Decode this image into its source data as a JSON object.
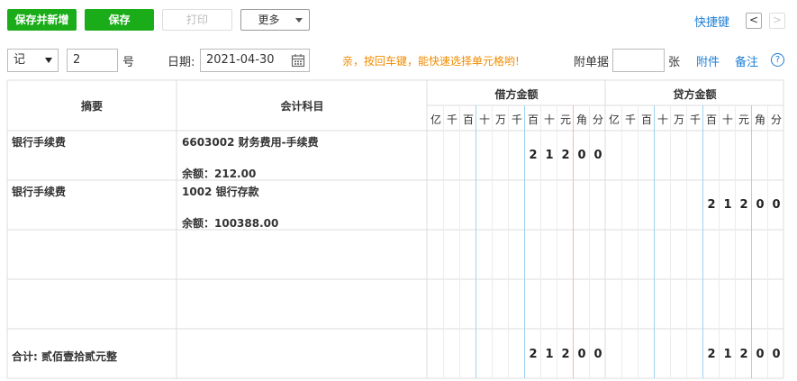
{
  "toolbar": {
    "save_new_label": "保存并新增",
    "save_label": "保存",
    "print_label": "打印",
    "more_label": "更多",
    "shortcut_label": "快捷键",
    "prev_label": "<",
    "next_label": ">"
  },
  "voucher": {
    "type_value": "记",
    "number_value": "2",
    "number_unit": "号",
    "date_label": "日期:",
    "date_value": "2021-04-30",
    "tip": "亲，按回车键，能快速选择单元格哟!",
    "attach_label": "附单据",
    "attach_value": "",
    "attach_unit": "张",
    "attachment_link": "附件",
    "remark_link": "备注",
    "help_icon": "?"
  },
  "table": {
    "col_summary": "摘要",
    "col_account": "会计科目",
    "col_debit": "借方金额",
    "col_credit": "贷方金额",
    "units": [
      "亿",
      "千",
      "百",
      "十",
      "万",
      "千",
      "百",
      "十",
      "元",
      "角",
      "分"
    ],
    "rows": [
      {
        "summary": "银行手续费",
        "account": "6603002 财务费用-手续费",
        "balance": "余额：212.00",
        "debit": "21200",
        "credit": ""
      },
      {
        "summary": "银行手续费",
        "account": "1002 银行存款",
        "balance": "余额：100388.00",
        "debit": "",
        "credit": "21200"
      },
      {
        "summary": "",
        "account": "",
        "balance": "",
        "debit": "",
        "credit": ""
      },
      {
        "summary": "",
        "account": "",
        "balance": "",
        "debit": "",
        "credit": ""
      }
    ],
    "total_label": "合计: 贰佰壹拾贰元整",
    "total_debit": "21200",
    "total_credit": "21200"
  },
  "colors": {
    "green": "#1aad19",
    "link": "#1e7fd6",
    "tip": "#f08c00",
    "blue_line": "#9fd3f0",
    "red_line": "#f2b8b0"
  }
}
